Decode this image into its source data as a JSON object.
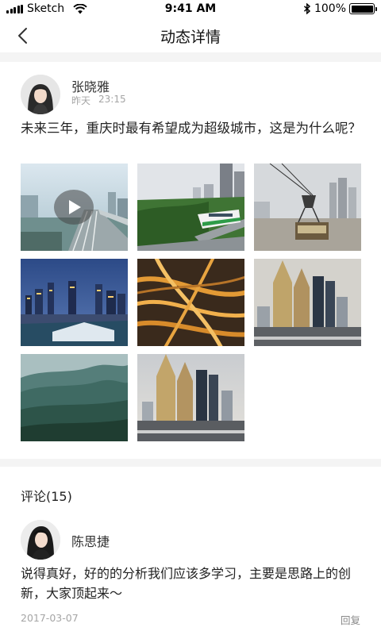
{
  "status_bar": {
    "carrier": "Sketch",
    "time": "9:41 AM",
    "battery": "100%"
  },
  "nav": {
    "title": "动态详情",
    "back_icon": "chevron-left-icon"
  },
  "post": {
    "author": "张晓雅",
    "time_day": "昨天",
    "time_clock": "23:15",
    "text": "未来三年，重庆时最有希望成为超级城市，这是为什么呢？",
    "photos": [
      {
        "name": "video-river-bridge",
        "has_video": true
      },
      {
        "name": "monorail-train"
      },
      {
        "name": "cable-car"
      },
      {
        "name": "night-skyline"
      },
      {
        "name": "highway-interchange"
      },
      {
        "name": "twin-towers"
      },
      {
        "name": "misty-mountains"
      },
      {
        "name": "twin-towers-2"
      }
    ]
  },
  "comments": {
    "title": "评论(15)",
    "items": [
      {
        "author": "陈思捷",
        "text": "说得真好，好的的分析我们应该多学习，主要是思路上的创新，大家顶起来～",
        "date": "2017-03-07",
        "reply_label": "回复"
      }
    ]
  }
}
